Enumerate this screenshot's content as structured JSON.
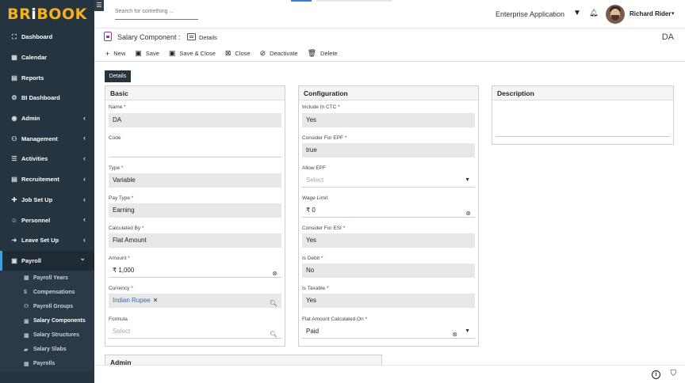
{
  "app": {
    "logo": {
      "b": "BR",
      "i": "i",
      "rest": "BOOK"
    }
  },
  "sidebar": {
    "items": [
      {
        "label": "Dashboard",
        "icon": "dashboard-icon",
        "glyph": "⛶",
        "chevron": false
      },
      {
        "label": "Calendar",
        "icon": "calendar-icon",
        "glyph": "▦",
        "chevron": false
      },
      {
        "label": "Reports",
        "icon": "reports-icon",
        "glyph": "▤",
        "chevron": false
      },
      {
        "label": "BI Dashboard",
        "icon": "bi-dashboard-icon",
        "glyph": "⚙",
        "chevron": false
      },
      {
        "label": "Admin",
        "icon": "admin-icon",
        "glyph": "◉",
        "chevron": true
      },
      {
        "label": "Management",
        "icon": "management-icon",
        "glyph": "⚇",
        "chevron": true
      },
      {
        "label": "Activities",
        "icon": "activities-icon",
        "glyph": "☰",
        "chevron": true
      },
      {
        "label": "Recruitement",
        "icon": "recruitment-icon",
        "glyph": "▤",
        "chevron": true
      },
      {
        "label": "Job Set Up",
        "icon": "job-setup-icon",
        "glyph": "✚",
        "chevron": true
      },
      {
        "label": "Personnel",
        "icon": "personnel-icon",
        "glyph": "☺",
        "chevron": true
      },
      {
        "label": "Leave Set Up",
        "icon": "leave-setup-icon",
        "glyph": "➜",
        "chevron": true
      }
    ],
    "open_item": {
      "label": "Payroll",
      "icon": "payroll-icon",
      "glyph": "▣"
    },
    "sub_items": [
      {
        "label": "Payroll Years",
        "icon": "payroll-years-icon",
        "glyph": "▦",
        "active": false
      },
      {
        "label": "Compensations",
        "icon": "compensations-icon",
        "glyph": "$",
        "active": false
      },
      {
        "label": "Payroll Groups",
        "icon": "payroll-groups-icon",
        "glyph": "⚇",
        "active": false
      },
      {
        "label": "Salary Components",
        "icon": "salary-components-icon",
        "glyph": "▣",
        "active": true
      },
      {
        "label": "Salary Structures",
        "icon": "salary-structures-icon",
        "glyph": "▦",
        "active": false
      },
      {
        "label": "Salary Slabs",
        "icon": "salary-slabs-icon",
        "glyph": "▰",
        "active": false
      },
      {
        "label": "Payrolls",
        "icon": "payrolls-icon",
        "glyph": "▦",
        "active": false
      }
    ]
  },
  "topbar": {
    "search_placeholder": "Search for something ...",
    "app_name": "Enterprise Application",
    "user_name": "Richard Rider"
  },
  "page": {
    "title": "Salary Component :",
    "view_label": "Details",
    "record_code": "DA",
    "tab_label": "Details"
  },
  "toolbar": {
    "new": "New",
    "save": "Save",
    "save_close": "Save & Close",
    "close": "Close",
    "deactivate": "Deactivate",
    "delete": "Delete"
  },
  "basic": {
    "header": "Basic",
    "name_label": "Name",
    "name_value": "DA",
    "code_label": "Code",
    "code_value": "",
    "type_label": "Type",
    "type_value": "Variable",
    "pay_type_label": "Pay Type",
    "pay_type_value": "Earning",
    "calc_by_label": "Calculated By",
    "calc_by_value": "Flat Amount",
    "amount_label": "Amount",
    "amount_value": "₹ 1,000",
    "currency_label": "Currency",
    "currency_value": "Indian Rupee",
    "formula_label": "Formula",
    "formula_placeholder": "Select"
  },
  "config": {
    "header": "Configuration",
    "ctc_label": "Include In CTC",
    "ctc_value": "Yes",
    "epf_label": "Consider For EPF",
    "epf_value": "true",
    "allow_epf_label": "Allow EPF",
    "allow_epf_placeholder": "Select",
    "wage_label": "Wage Limit",
    "wage_value": "₹ 0",
    "esi_label": "Consider For ESI",
    "esi_value": "Yes",
    "debit_label": "Is Debit",
    "debit_value": "No",
    "taxable_label": "Is Taxable",
    "taxable_value": "Yes",
    "flat_label": "Flat Amount Calculated On",
    "flat_value": "Paid"
  },
  "description": {
    "header": "Description"
  },
  "admin": {
    "header": "Admin"
  }
}
